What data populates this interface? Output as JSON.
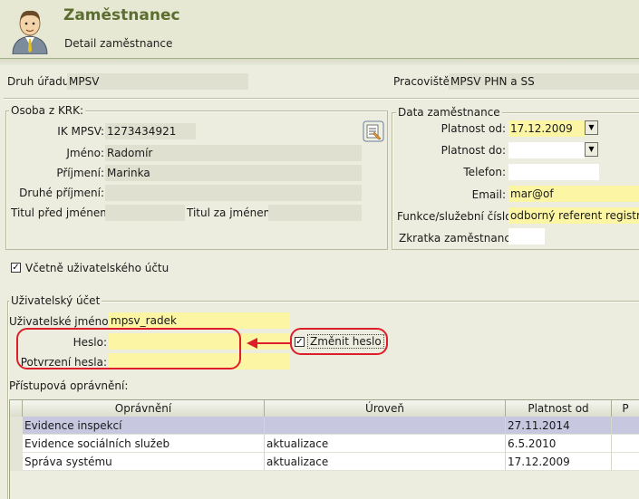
{
  "header": {
    "title": "Zaměstnanec",
    "subtitle": "Detail zaměstnance"
  },
  "top": {
    "druh_uradu_label": "Druh úřadu:",
    "druh_uradu_value": "MPSV",
    "pracoviste_label": "Pracoviště:",
    "pracoviste_value": "MPSV PHN a SS"
  },
  "osoba": {
    "legend": "Osoba z KRK:",
    "ik_label": "IK MPSV:",
    "ik_value": "1273434921",
    "jmeno_label": "Jméno:",
    "jmeno_value": "Radomír",
    "prijmeni_label": "Příjmení:",
    "prijmeni_value": "Marinka",
    "druhe_prijmeni_label": "Druhé příjmení:",
    "druhe_prijmeni_value": "",
    "titul_pred_label": "Titul před jménem:",
    "titul_pred_value": "",
    "titul_za_label": "Titul za jménem:",
    "titul_za_value": ""
  },
  "data_zam": {
    "legend": "Data zaměstnance",
    "platnost_od_label": "Platnost od:",
    "platnost_od_value": "17.12.2009",
    "platnost_do_label": "Platnost do:",
    "platnost_do_value": "",
    "telefon_label": "Telefon:",
    "telefon_value": "",
    "email_label": "Email:",
    "email_value": "mar@of",
    "funkce_label": "Funkce/služební číslo:",
    "funkce_value": "odborný referent registru p",
    "zkratka_label": "Zkratka zaměstnance:",
    "zkratka_value": ""
  },
  "vcetne": {
    "label": "Včetně uživatelského účtu",
    "checked": true
  },
  "ucet": {
    "legend": "Uživatelský účet",
    "username_label": "Uživatelské jméno:",
    "username_value": "mpsv_radek",
    "heslo_label": "Heslo:",
    "heslo_value": "",
    "potvrzeni_label": "Potvrzení hesla:",
    "potvrzeni_value": "",
    "zmenit_label": "Změnit heslo",
    "zmenit_checked": true
  },
  "opravneni": {
    "label": "Přístupová oprávnění:",
    "columns": [
      "Oprávnění",
      "Úroveň",
      "Platnost od",
      "P"
    ],
    "rows": [
      {
        "opravneni": "Evidence inspekcí",
        "uroven": "",
        "platnost_od": "27.11.2014"
      },
      {
        "opravneni": "Evidence sociálních služeb",
        "uroven": "aktualizace",
        "platnost_od": "6.5.2010"
      },
      {
        "opravneni": "Správa systému",
        "uroven": "aktualizace",
        "platnost_od": "17.12.2009"
      }
    ]
  },
  "icons": {
    "avatar": "user-avatar-icon",
    "lookup": "lookup-edit-icon",
    "dropdown": "chevron-down-icon",
    "arrow": "arrow-left-icon"
  },
  "colors": {
    "title_green": "#5b6e2f",
    "field_yellow": "#fbf5a4",
    "field_gray": "#dfe0cf",
    "annotation_red": "#dd1e2a",
    "selected_row": "#c7c8e0"
  }
}
